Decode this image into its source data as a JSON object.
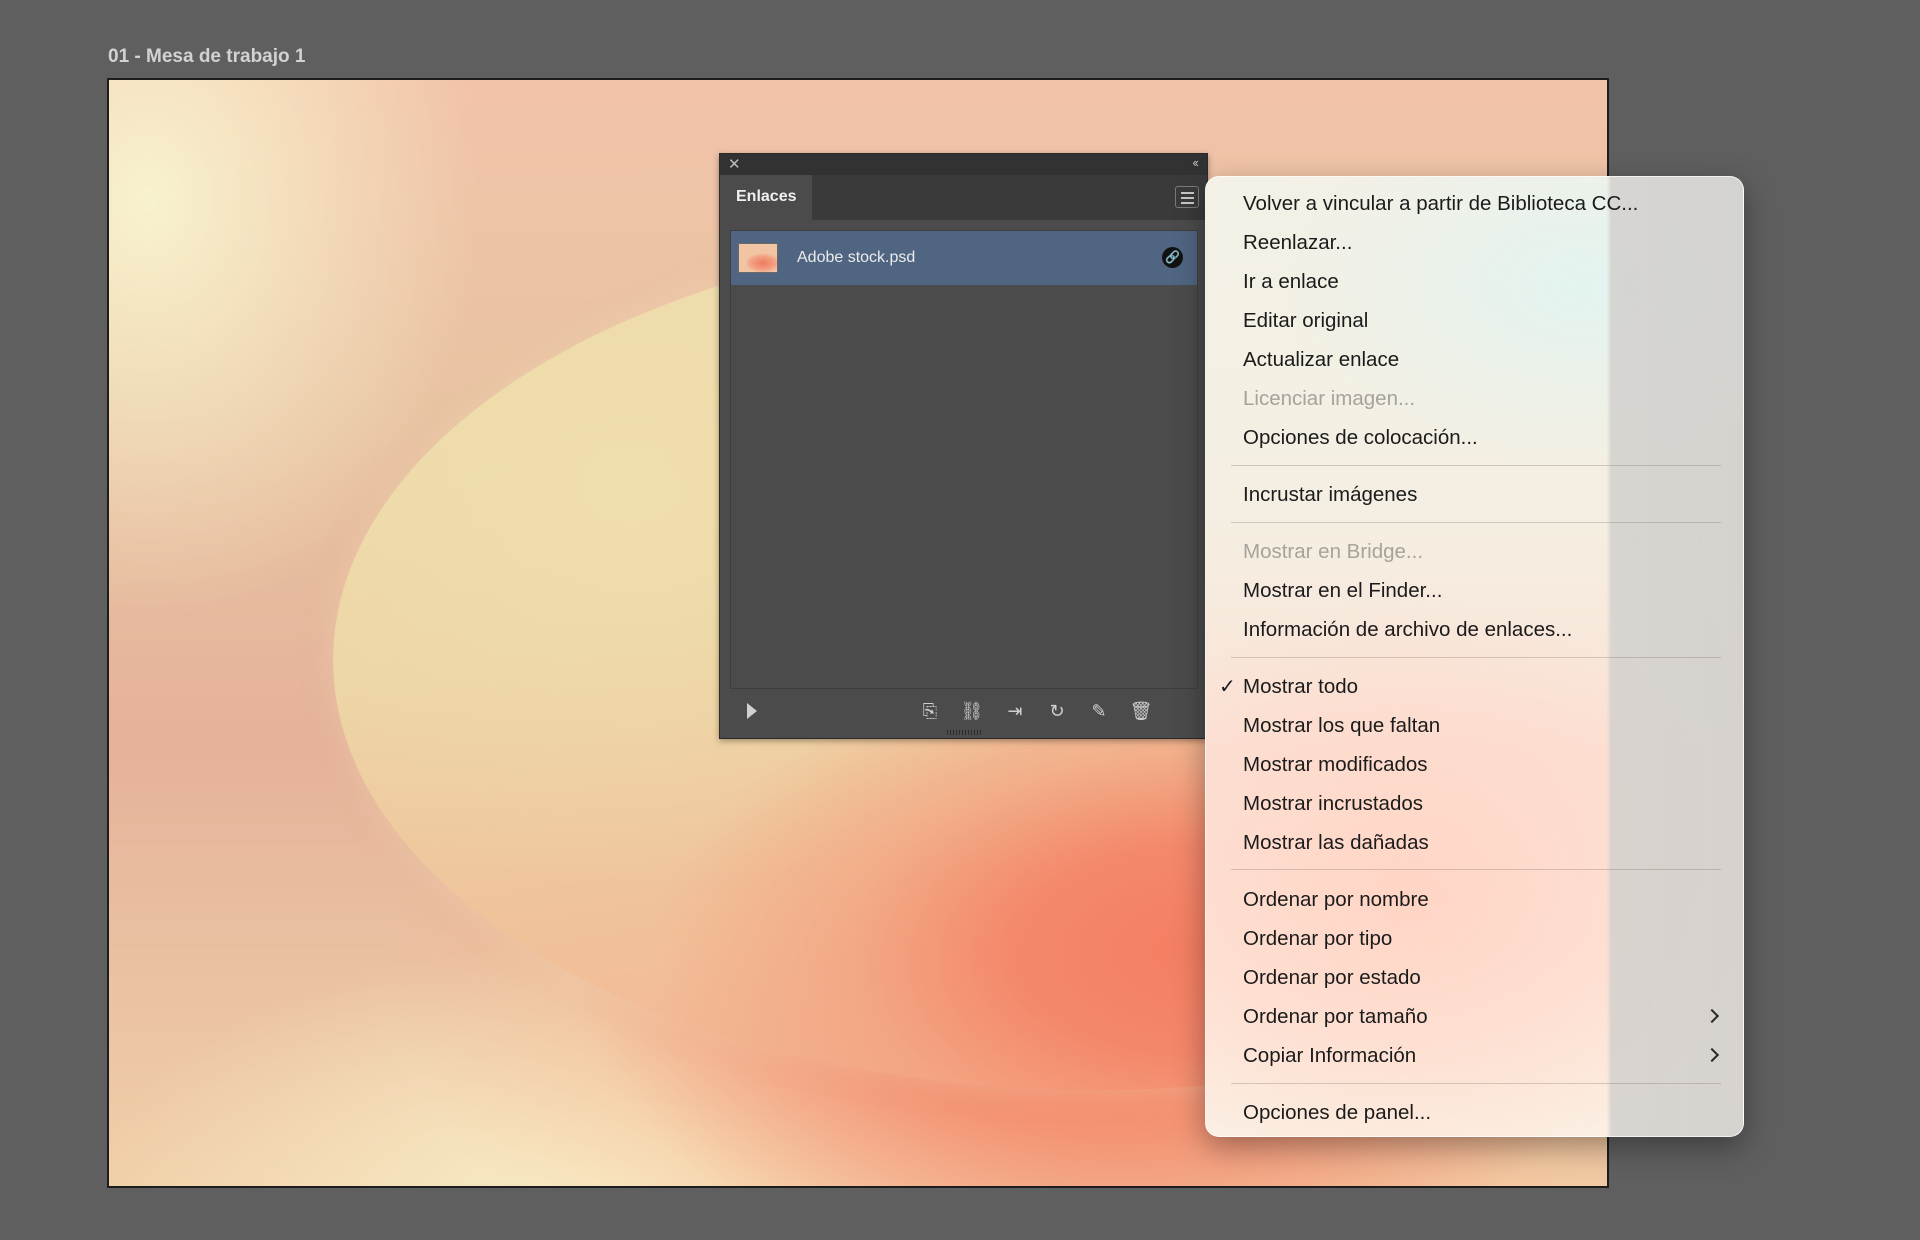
{
  "artboard": {
    "label": "01 - Mesa de trabajo 1"
  },
  "panel": {
    "close_glyph": "✕",
    "collapse_glyph": "‹‹",
    "tab_label": "Enlaces",
    "links": [
      {
        "name": "Adobe stock.psd",
        "status_icon": "link-icon",
        "status_glyph": "🔗"
      }
    ],
    "toolbar": [
      {
        "name": "relink-from-cc-icon",
        "glyph": "⎘"
      },
      {
        "name": "relink-icon",
        "glyph": "⛓"
      },
      {
        "name": "go-to-link-icon",
        "glyph": "⇥"
      },
      {
        "name": "update-link-icon",
        "glyph": "↻"
      },
      {
        "name": "edit-original-icon",
        "glyph": "✎"
      },
      {
        "name": "trash-icon",
        "glyph": "🗑"
      }
    ]
  },
  "menu": {
    "items": [
      {
        "label": "Volver a vincular a partir de Biblioteca CC...",
        "enabled": true
      },
      {
        "label": "Reenlazar...",
        "enabled": true
      },
      {
        "label": "Ir a enlace",
        "enabled": true
      },
      {
        "label": "Editar original",
        "enabled": true
      },
      {
        "label": "Actualizar enlace",
        "enabled": true
      },
      {
        "label": "Licenciar imagen...",
        "enabled": false
      },
      {
        "label": "Opciones de colocación...",
        "enabled": true
      },
      {
        "label": "Incrustar imágenes",
        "enabled": true
      },
      {
        "label": "Mostrar en Bridge...",
        "enabled": false
      },
      {
        "label": "Mostrar en el Finder...",
        "enabled": true
      },
      {
        "label": "Información de archivo de enlaces...",
        "enabled": true
      },
      {
        "label": "Mostrar todo",
        "enabled": true,
        "checked": true
      },
      {
        "label": "Mostrar los que faltan",
        "enabled": true
      },
      {
        "label": "Mostrar modificados",
        "enabled": true
      },
      {
        "label": "Mostrar incrustados",
        "enabled": true
      },
      {
        "label": "Mostrar las dañadas",
        "enabled": true
      },
      {
        "label": "Ordenar por nombre",
        "enabled": true
      },
      {
        "label": "Ordenar por tipo",
        "enabled": true
      },
      {
        "label": "Ordenar por estado",
        "enabled": true
      },
      {
        "label": "Ordenar por tamaño",
        "enabled": true,
        "submenu": true
      },
      {
        "label": "Copiar Información",
        "enabled": true,
        "submenu": true
      },
      {
        "label": "Opciones de panel...",
        "enabled": true
      }
    ],
    "check_glyph": "✓"
  }
}
